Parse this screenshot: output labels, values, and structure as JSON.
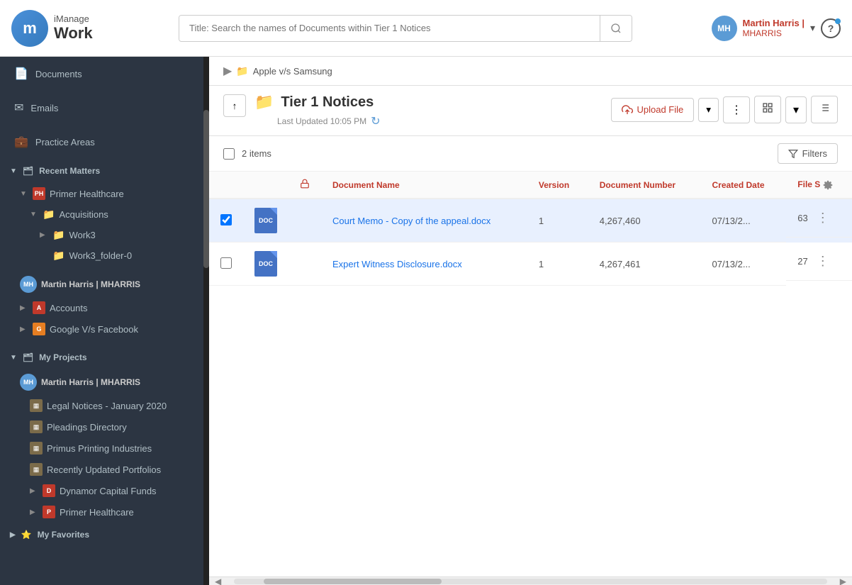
{
  "header": {
    "logo_letter": "m",
    "imanage_label": "iManage",
    "work_label": "Work",
    "search_placeholder": "Title: Search the names of Documents within Tier 1 Notices",
    "user_initials": "MH",
    "user_name": "Martin Harris |",
    "user_id": "MHARRIS",
    "help_label": "?"
  },
  "sidebar": {
    "nav_items": [
      {
        "icon": "📄",
        "label": "Documents"
      },
      {
        "icon": "✉",
        "label": "Emails"
      },
      {
        "icon": "💼",
        "label": "Practice Areas"
      }
    ],
    "recent_matters": {
      "label": "Recent Matters",
      "items": [
        {
          "label": "Primer Healthcare",
          "indent": 1,
          "type": "matter",
          "expanded": true,
          "children": [
            {
              "label": "Acquisitions",
              "indent": 2,
              "type": "folder",
              "expanded": true,
              "children": [
                {
                  "label": "Work3",
                  "indent": 3,
                  "type": "folder"
                },
                {
                  "label": "Work3_folder-0",
                  "indent": 3,
                  "type": "folder"
                }
              ]
            }
          ]
        }
      ]
    },
    "user_section": {
      "initials": "MH",
      "label": "Martin Harris | MHARRIS"
    },
    "account_items": [
      {
        "label": "Accounts",
        "type": "matter"
      },
      {
        "label": "Google V/s Facebook",
        "type": "matter"
      }
    ],
    "my_projects": {
      "label": "My Projects",
      "user_initials": "MH",
      "user_label": "Martin Harris | MHARRIS",
      "items": [
        {
          "label": "Legal Notices - January 2020",
          "type": "project"
        },
        {
          "label": "Pleadings Directory",
          "type": "project"
        },
        {
          "label": "Primus Printing Industries",
          "type": "project"
        },
        {
          "label": "Recently Updated Portfolios",
          "type": "project"
        },
        {
          "label": "Dynamor Capital Funds",
          "type": "project"
        },
        {
          "label": "Primer Healthcare",
          "type": "project"
        }
      ]
    },
    "my_favorites": {
      "label": "My Favorites"
    }
  },
  "breadcrumb": {
    "parent": "Apple v/s Samsung"
  },
  "folder": {
    "title": "Tier 1 Notices",
    "last_updated_label": "Last Updated 10:05 PM",
    "back_arrow": "↑",
    "upload_label": "Upload File"
  },
  "table": {
    "item_count": "2 items",
    "filter_label": "Filters",
    "columns": [
      "Document Name",
      "Version",
      "Document Number",
      "Created Date",
      "File S"
    ],
    "rows": [
      {
        "id": 1,
        "name": "Court Memo - Copy of the appeal.docx",
        "version": "1",
        "doc_number": "4,267,460",
        "created_date": "07/13/2...",
        "file_size": "63",
        "selected": true
      },
      {
        "id": 2,
        "name": "Expert Witness Disclosure.docx",
        "version": "1",
        "doc_number": "4,267,461",
        "created_date": "07/13/2...",
        "file_size": "27",
        "selected": false
      }
    ]
  }
}
